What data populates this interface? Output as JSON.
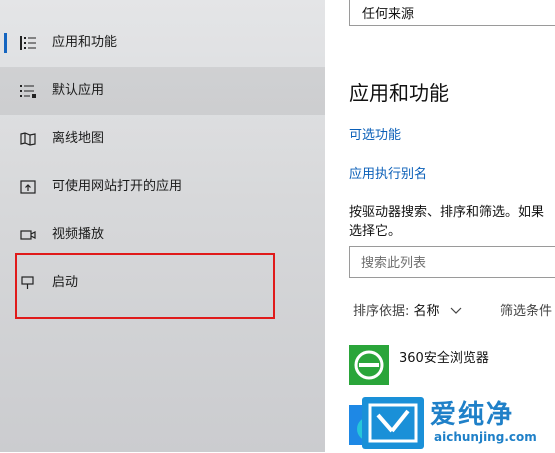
{
  "sidebar": {
    "items": [
      {
        "label": "应用和功能",
        "icon": "apps-list-icon"
      },
      {
        "label": "默认应用",
        "icon": "default-apps-icon"
      },
      {
        "label": "离线地图",
        "icon": "offline-map-icon"
      },
      {
        "label": "可使用网站打开的应用",
        "icon": "open-with-website-icon"
      },
      {
        "label": "视频播放",
        "icon": "video-playback-icon"
      },
      {
        "label": "启动",
        "icon": "startup-icon"
      }
    ]
  },
  "main": {
    "dropdown_value": "任何来源",
    "title": "应用和功能",
    "links": [
      "可选功能",
      "应用执行别名"
    ],
    "description": "按驱动器搜索、排序和筛选。如果选择它。",
    "search_placeholder": "搜索此列表",
    "sort_label": "排序依据:",
    "sort_value": "名称",
    "filter_label": "筛选条件",
    "apps": [
      {
        "name": "360安全浏览器"
      }
    ]
  },
  "watermark": {
    "title": "爱纯净",
    "url": "aichunjing.com"
  },
  "colors": {
    "accent": "#1565c0",
    "link": "#0a5fb8",
    "highlight": "#e01a1a",
    "app_icon_360": "#2aa53a"
  }
}
